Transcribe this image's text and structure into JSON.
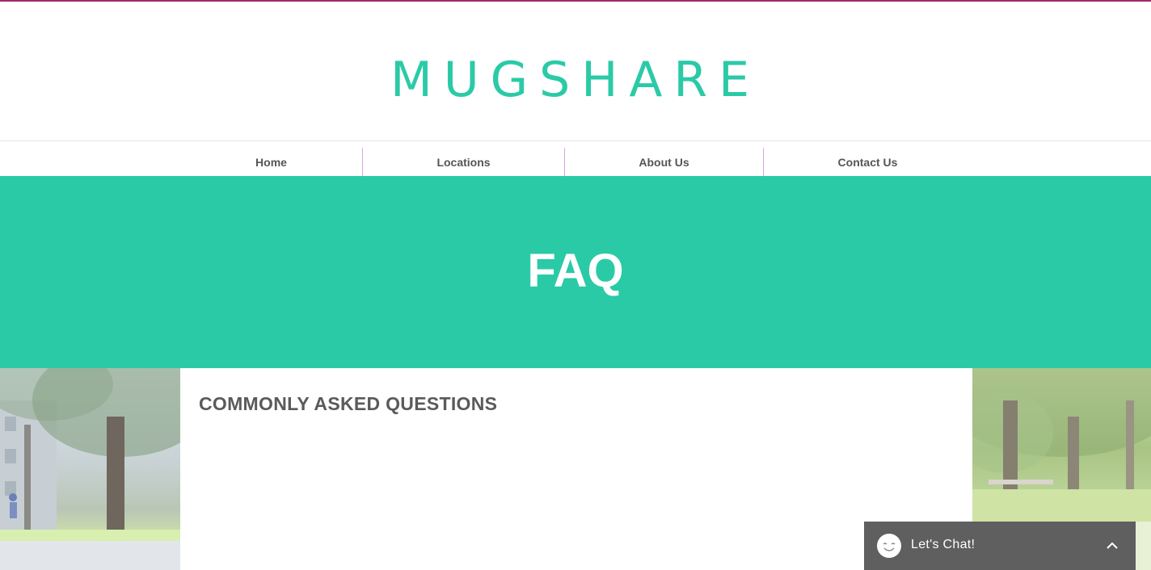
{
  "header": {
    "logo_text": "MUGSHARE"
  },
  "nav": {
    "items": [
      {
        "label": "Home"
      },
      {
        "label": "Locations"
      },
      {
        "label": "About Us"
      },
      {
        "label": "Contact Us"
      }
    ]
  },
  "hero": {
    "title": "FAQ",
    "background_color": "#2bcaa7"
  },
  "main": {
    "heading": "COMMONLY ASKED QUESTIONS"
  },
  "chat_widget": {
    "label": "Let's Chat!",
    "icons": [
      "smiley-icon",
      "chevron-up-icon"
    ]
  },
  "colors": {
    "brand": "#2bcaa7",
    "accent_line": "#a0286e",
    "nav_separator": "#d7a8de",
    "chat_bg": "#5f5f5f"
  }
}
